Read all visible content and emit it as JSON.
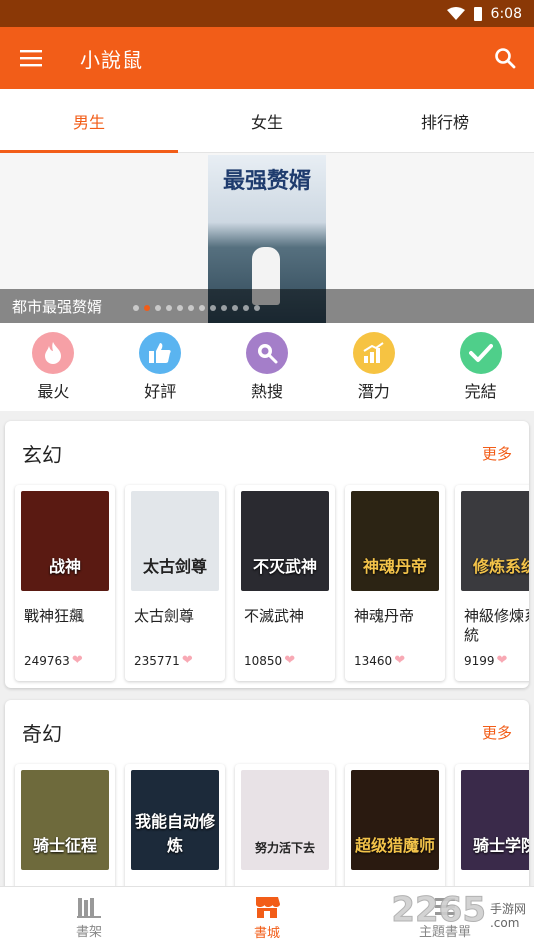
{
  "status_bar": {
    "time": "6:08"
  },
  "app_bar": {
    "title": "小說鼠"
  },
  "tabs": [
    {
      "label": "男生",
      "active": true
    },
    {
      "label": "女生",
      "active": false
    },
    {
      "label": "排行榜",
      "active": false
    }
  ],
  "banner": {
    "caption": "都市最强赘婿",
    "cover_title": "最强赘婿",
    "slide_count": 12,
    "active_slide": 1
  },
  "categories": [
    {
      "label": "最火",
      "icon": "flame-icon",
      "color": "#f6a0a6"
    },
    {
      "label": "好評",
      "icon": "thumbs-up-icon",
      "color": "#5ab4f0"
    },
    {
      "label": "熱搜",
      "icon": "search-icon",
      "color": "#a47ec9"
    },
    {
      "label": "潛力",
      "icon": "chart-icon",
      "color": "#f6c342"
    },
    {
      "label": "完結",
      "icon": "check-icon",
      "color": "#4fcf8a"
    }
  ],
  "sections": [
    {
      "title": "玄幻",
      "more": "更多",
      "books": [
        {
          "name": "戰神狂飆",
          "count": "249763",
          "cover_text": "战神",
          "bg": "#5a1a12"
        },
        {
          "name": "太古劍尊",
          "count": "235771",
          "cover_text": "太古剑尊",
          "bg": "#e2e6ea"
        },
        {
          "name": "不滅武神",
          "count": "10850",
          "cover_text": "不灭武神",
          "bg": "#2a2a30"
        },
        {
          "name": "神魂丹帝",
          "count": "13460",
          "cover_text": "神魂丹帝",
          "bg": "#2c2414"
        },
        {
          "name": "神級修煉系統",
          "count": "9199",
          "cover_text": "修炼系统",
          "bg": "#3a3a3e"
        }
      ]
    },
    {
      "title": "奇幻",
      "more": "更多",
      "books": [
        {
          "name": "",
          "count": "",
          "cover_text": "骑士征程",
          "bg": "#6e6a3c"
        },
        {
          "name": "",
          "count": "",
          "cover_text": "我能自动修炼",
          "bg": "#1c2a3a"
        },
        {
          "name": "",
          "count": "",
          "cover_text": "努力活下去",
          "bg": "#e8e2e6"
        },
        {
          "name": "",
          "count": "",
          "cover_text": "超级猎魔师",
          "bg": "#2a1a10"
        },
        {
          "name": "",
          "count": "",
          "cover_text": "骑士学院",
          "bg": "#3a2a4a"
        }
      ]
    }
  ],
  "bottom_nav": [
    {
      "label": "書架",
      "icon": "bookshelf-icon",
      "active": false
    },
    {
      "label": "書城",
      "icon": "store-icon",
      "active": true
    },
    {
      "label": "主題書單",
      "icon": "list-icon",
      "active": false
    }
  ],
  "watermark": {
    "number": "2265",
    "line1": "手游网",
    "line2": ".com"
  }
}
